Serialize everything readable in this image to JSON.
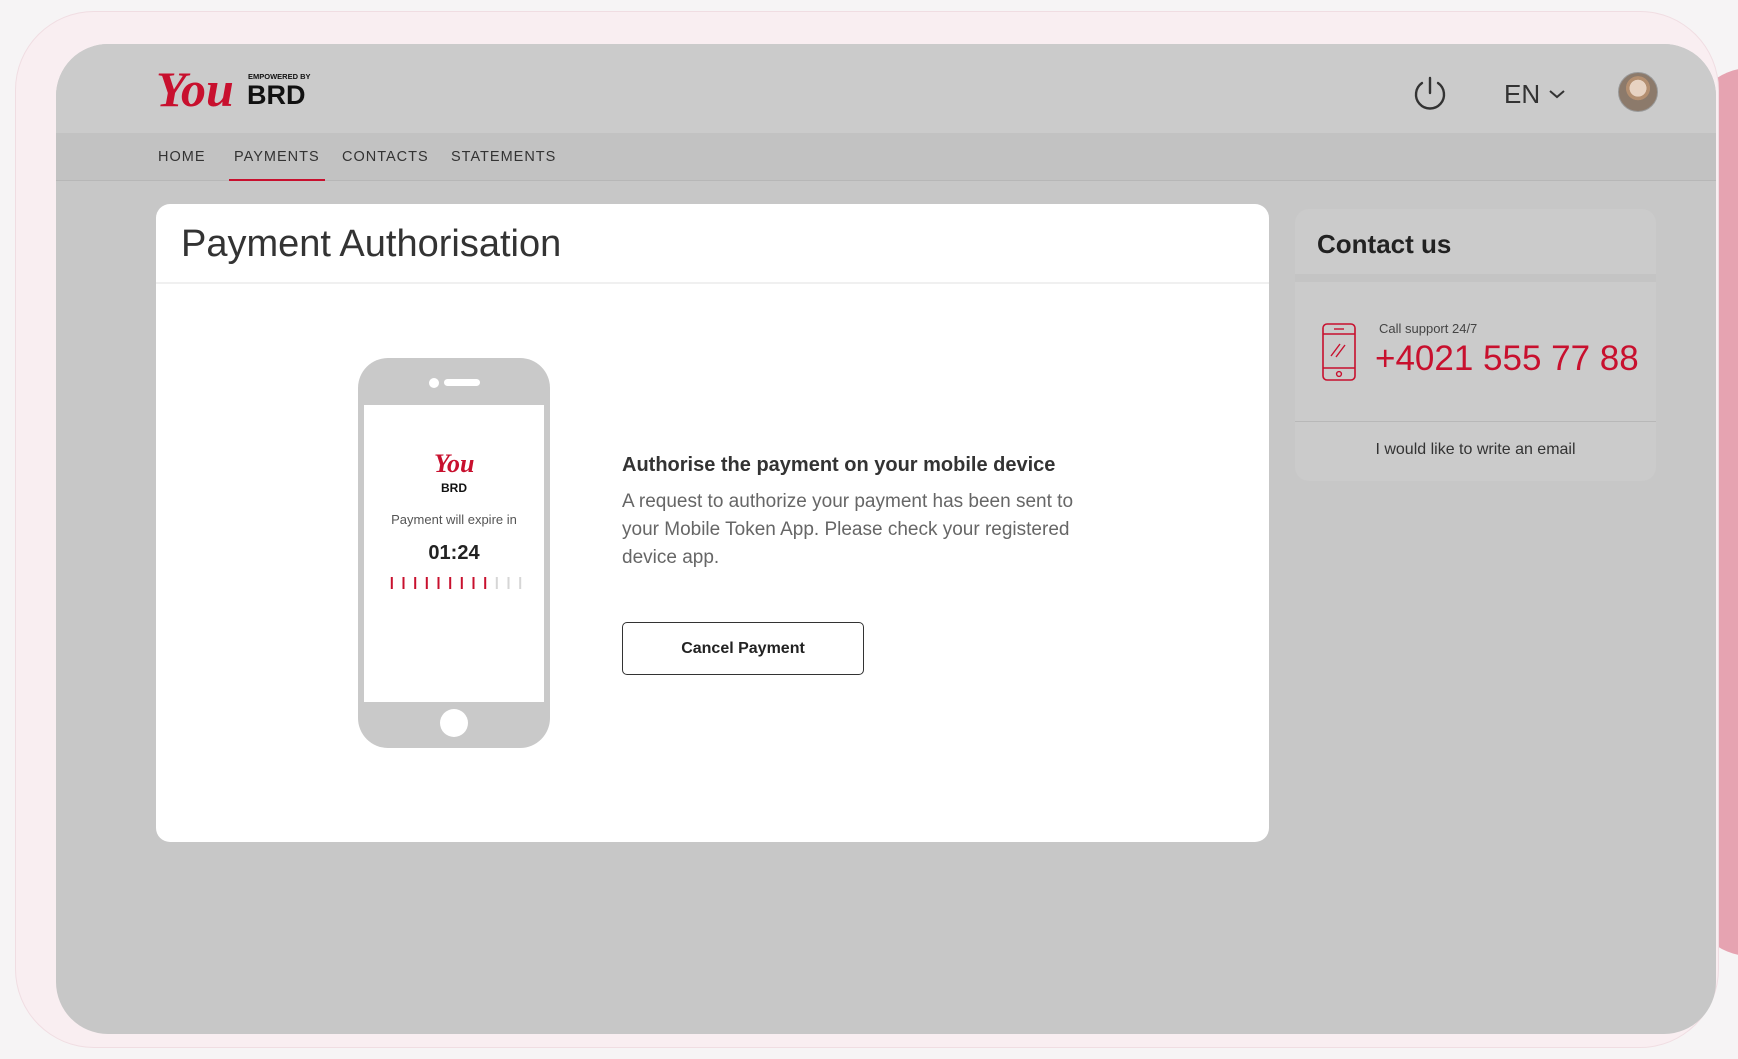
{
  "brand": {
    "logo_word": "You",
    "logo_tagline": "EMPOWERED BY",
    "logo_bank": "BRD",
    "accent_color": "#c8102e"
  },
  "header": {
    "language": "EN",
    "icons": [
      "power-icon",
      "chevron-down-icon",
      "avatar"
    ]
  },
  "nav": {
    "items": [
      {
        "label": "HOME",
        "active": false
      },
      {
        "label": "PAYMENTS",
        "active": true
      },
      {
        "label": "CONTACTS",
        "active": false
      },
      {
        "label": "STATEMENTS",
        "active": false
      }
    ]
  },
  "main": {
    "title": "Payment Authorisation",
    "phone": {
      "expire_label": "Payment will expire in",
      "timer": "01:24",
      "ticks_total": 12,
      "ticks_active": 9
    },
    "auth_title": "Authorise the payment on your mobile device",
    "auth_description": "A request to authorize your payment has been sent to your Mobile Token App. Please check your registered device app.",
    "cancel_label": "Cancel Payment"
  },
  "contact": {
    "title": "Contact us",
    "support_label": "Call support 24/7",
    "support_number": "+4021 555 77 88",
    "email_link": "I would like to write an email"
  }
}
